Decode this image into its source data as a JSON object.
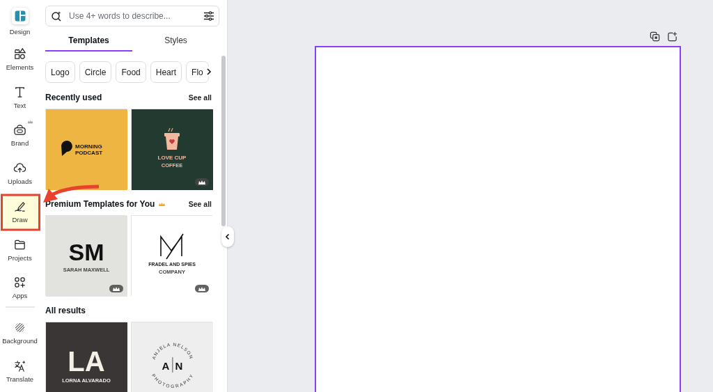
{
  "sidebar": {
    "items": [
      {
        "kind": "design",
        "label": "Design",
        "selected": false,
        "premium": false
      },
      {
        "kind": "elements",
        "label": "Elements",
        "selected": false,
        "premium": false
      },
      {
        "kind": "text",
        "label": "Text",
        "selected": false,
        "premium": false
      },
      {
        "kind": "brand",
        "label": "Brand",
        "selected": false,
        "premium": true
      },
      {
        "kind": "uploads",
        "label": "Uploads",
        "selected": false,
        "premium": false
      },
      {
        "kind": "draw",
        "label": "Draw",
        "selected": true,
        "premium": false
      },
      {
        "kind": "projects",
        "label": "Projects",
        "selected": false,
        "premium": false
      },
      {
        "kind": "apps",
        "label": "Apps",
        "selected": false,
        "premium": false
      },
      {
        "kind": "background",
        "label": "Background",
        "selected": false,
        "premium": false
      },
      {
        "kind": "translate",
        "label": "Translate",
        "selected": false,
        "premium": false
      }
    ]
  },
  "panel": {
    "search": {
      "placeholder": "Use 4+ words to describe..."
    },
    "tabs": [
      {
        "label": "Templates",
        "selected": true
      },
      {
        "label": "Styles",
        "selected": false
      }
    ],
    "chips": [
      "Logo",
      "Circle",
      "Food",
      "Heart",
      "Flo"
    ],
    "sections": [
      {
        "title": "Recently used",
        "premium": false,
        "link": "See all",
        "templates": [
          {
            "kind": "podcast",
            "lines": [
              "MORNING",
              "PODCAST"
            ],
            "premium": false
          },
          {
            "kind": "cup",
            "lines": [
              "LOVE CUP",
              "COFFEE"
            ],
            "premium": true
          }
        ]
      },
      {
        "title": "Premium Templates for You",
        "premium": true,
        "link": "See all",
        "templates": [
          {
            "kind": "sm",
            "lines": [
              "SM",
              "SARAH MAXWELL"
            ],
            "premium": true
          },
          {
            "kind": "fm",
            "lines": [
              "FRADEL AND SPIES",
              "COMPANY"
            ],
            "premium": true
          }
        ]
      },
      {
        "title": "All results",
        "premium": false,
        "templates": [
          {
            "kind": "la",
            "lines": [
              "LA",
              "LORNA ALVARADO"
            ],
            "premium": false
          },
          {
            "kind": "an",
            "lines": [
              "ANJELA NELSON",
              "A",
              "N",
              "PHOTOGRAPHY"
            ],
            "premium": false
          }
        ]
      }
    ]
  }
}
